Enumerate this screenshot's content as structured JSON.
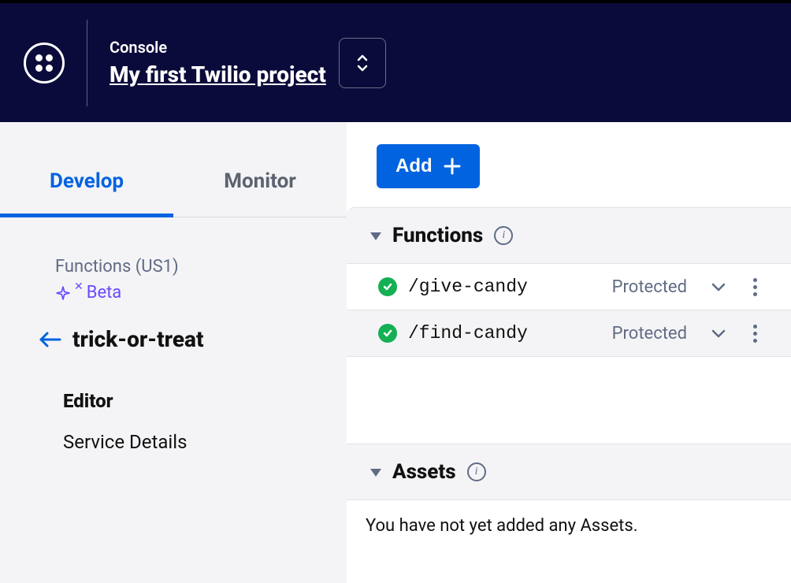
{
  "header": {
    "console_label": "Console",
    "project_name": "My first Twilio project"
  },
  "sidebar": {
    "tabs": {
      "develop": "Develop",
      "monitor": "Monitor"
    },
    "region_label": "Functions (US1)",
    "beta_label": "Beta",
    "service_name": "trick-or-treat",
    "nav": {
      "editor": "Editor",
      "service_details": "Service Details"
    }
  },
  "main": {
    "add_label": "Add",
    "functions_header": "Functions",
    "assets_header": "Assets",
    "functions": [
      {
        "path": "/give-candy",
        "visibility": "Protected",
        "selected": false
      },
      {
        "path": "/find-candy",
        "visibility": "Protected",
        "selected": true
      }
    ],
    "assets_empty": "You have not yet added any Assets."
  }
}
